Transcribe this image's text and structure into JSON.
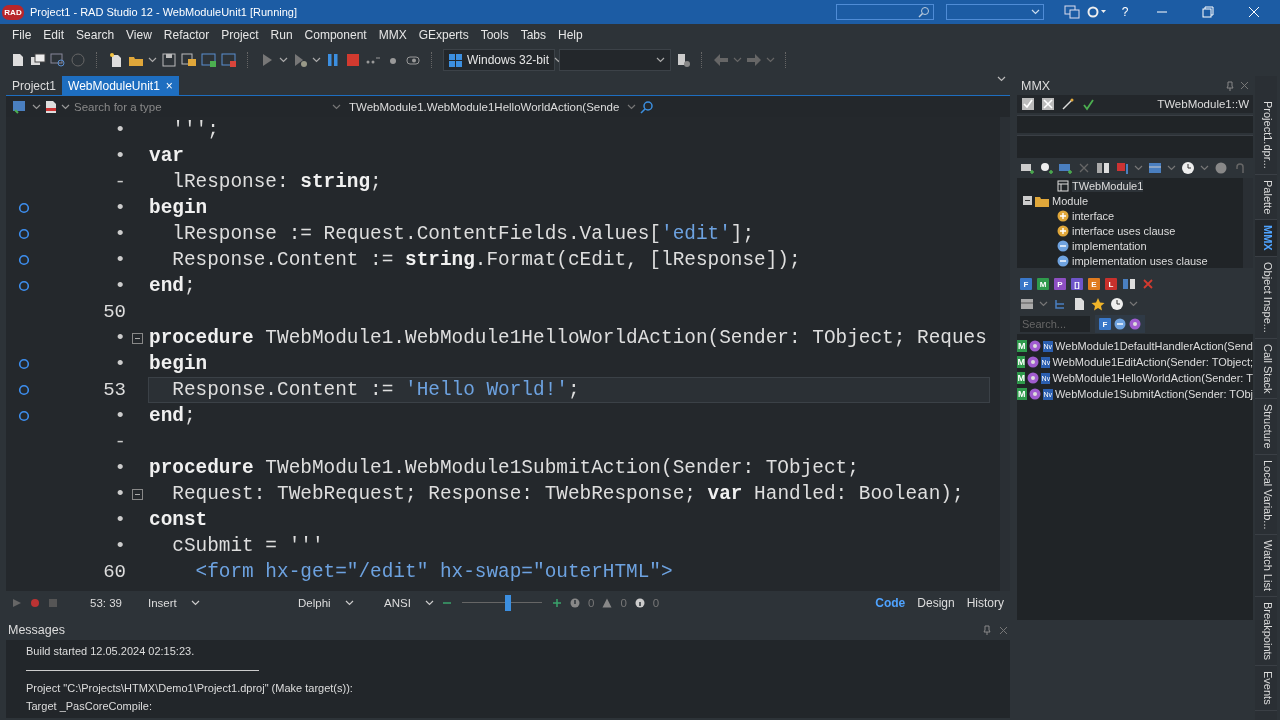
{
  "window": {
    "logo": "RAD",
    "title": "Project1 - RAD Studio 12 - WebModuleUnit1 [Running]",
    "help": "?"
  },
  "menu": [
    "File",
    "Edit",
    "Search",
    "View",
    "Refactor",
    "Project",
    "Run",
    "Component",
    "MMX",
    "GExperts",
    "Tools",
    "Tabs",
    "Help"
  ],
  "toolbar": {
    "platform": "Windows 32-bit"
  },
  "editor": {
    "tabs": [
      {
        "label": "Project1",
        "selected": false
      },
      {
        "label": "WebModuleUnit1",
        "selected": true,
        "close": "×"
      }
    ],
    "search_placeholder": "Search for a type",
    "method": "TWebModule1.WebModule1HelloWorldAction(Sende",
    "lines": [
      {
        "gutter": "•",
        "marker": false,
        "fold": false,
        "current": false,
        "tokens": [
          {
            "kind": "id",
            "text": "  ''';"
          }
        ]
      },
      {
        "gutter": "•",
        "marker": false,
        "fold": false,
        "current": false,
        "tokens": [
          {
            "kind": "kw",
            "text": "var"
          }
        ]
      },
      {
        "gutter": "-",
        "marker": false,
        "fold": false,
        "current": false,
        "tokens": [
          {
            "kind": "id",
            "text": "  lResponse: "
          },
          {
            "kind": "kw",
            "text": "string"
          },
          {
            "kind": "id",
            "text": ";"
          }
        ]
      },
      {
        "gutter": "•",
        "marker": true,
        "fold": false,
        "current": false,
        "tokens": [
          {
            "kind": "kw",
            "text": "begin"
          }
        ]
      },
      {
        "gutter": "•",
        "marker": true,
        "fold": false,
        "current": false,
        "tokens": [
          {
            "kind": "id",
            "text": "  lResponse := Request.ContentFields.Values["
          },
          {
            "kind": "str",
            "text": "'edit'"
          },
          {
            "kind": "id",
            "text": "];"
          }
        ]
      },
      {
        "gutter": "•",
        "marker": true,
        "fold": false,
        "current": false,
        "tokens": [
          {
            "kind": "id",
            "text": "  Response.Content := "
          },
          {
            "kind": "kw",
            "text": "string"
          },
          {
            "kind": "id",
            "text": ".Format(cEdit, [lResponse]);"
          }
        ]
      },
      {
        "gutter": "•",
        "marker": true,
        "fold": false,
        "current": false,
        "tokens": [
          {
            "kind": "kw",
            "text": "end"
          },
          {
            "kind": "id",
            "text": ";"
          }
        ]
      },
      {
        "gutter": "50",
        "marker": false,
        "fold": false,
        "current": false
      },
      {
        "gutter": "•",
        "marker": false,
        "fold": true,
        "current": false,
        "tokens": [
          {
            "kind": "kw",
            "text": "procedure"
          },
          {
            "kind": "id",
            "text": " TWebModule1.WebModule1HelloWorldAction(Sender: TObject; Reques"
          }
        ]
      },
      {
        "gutter": "•",
        "marker": true,
        "fold": false,
        "current": false,
        "tokens": [
          {
            "kind": "kw",
            "text": "begin"
          }
        ]
      },
      {
        "gutter": "53",
        "marker": true,
        "fold": false,
        "current": true,
        "tokens": [
          {
            "kind": "id",
            "text": "  Response.Content := "
          },
          {
            "kind": "str",
            "text": "'Hello World!'"
          },
          {
            "kind": "id",
            "text": ";"
          }
        ]
      },
      {
        "gutter": "•",
        "marker": true,
        "fold": false,
        "current": false,
        "tokens": [
          {
            "kind": "kw",
            "text": "end"
          },
          {
            "kind": "id",
            "text": ";"
          }
        ]
      },
      {
        "gutter": "-",
        "marker": false,
        "fold": false,
        "current": false
      },
      {
        "gutter": "•",
        "marker": false,
        "fold": false,
        "current": false,
        "tokens": [
          {
            "kind": "kw",
            "text": "procedure"
          },
          {
            "kind": "id",
            "text": " TWebModule1.WebModule1SubmitAction(Sender: TObject;"
          }
        ]
      },
      {
        "gutter": "•",
        "marker": false,
        "fold": true,
        "current": false,
        "tokens": [
          {
            "kind": "id",
            "text": "  Request: TWebRequest; Response: TWebResponse; "
          },
          {
            "kind": "kw",
            "text": "var"
          },
          {
            "kind": "id",
            "text": " Handled: Boolean);"
          }
        ]
      },
      {
        "gutter": "•",
        "marker": false,
        "fold": false,
        "current": false,
        "tokens": [
          {
            "kind": "kw",
            "text": "const"
          }
        ]
      },
      {
        "gutter": "•",
        "marker": false,
        "fold": false,
        "current": false,
        "tokens": [
          {
            "kind": "id",
            "text": "  cSubmit = '''"
          }
        ]
      },
      {
        "gutter": "60",
        "marker": false,
        "fold": false,
        "current": false,
        "tokens": [
          {
            "kind": "str",
            "text": "    <form hx-get=\"/edit\" hx-swap=\"outerHTML\">"
          }
        ]
      }
    ]
  },
  "status": {
    "position": "53: 39",
    "mode": "Insert",
    "language": "Delphi",
    "encoding": "ANSI",
    "zoom": {
      "level": 0.58
    },
    "errors": "0",
    "warnings": "0",
    "hints": "0",
    "views": [
      {
        "label": "Code",
        "selected": true
      },
      {
        "label": "Design",
        "selected": false
      },
      {
        "label": "History",
        "selected": false
      }
    ]
  },
  "mmx": {
    "title": "MMX",
    "context": "TWebModule1::W",
    "tree": [
      {
        "text": "TWebModule1",
        "kind": "class",
        "selected": true
      },
      {
        "text": "Module",
        "kind": "folder",
        "selected": false,
        "expanded": true,
        "children": [
          {
            "text": "interface",
            "kind": "plus",
            "selected": false
          },
          {
            "text": "interface uses clause",
            "kind": "plus",
            "selected": false
          },
          {
            "text": "implementation",
            "kind": "minus",
            "selected": false
          },
          {
            "text": "implementation uses clause",
            "kind": "minus",
            "selected": false
          }
        ]
      }
    ],
    "add_buttons": [
      {
        "label": "F",
        "color": "#3a78c9"
      },
      {
        "label": "M",
        "color": "#2f9a4c"
      },
      {
        "label": "P",
        "color": "#8d4fc2"
      },
      {
        "label": "[]",
        "color": "#6e55c9"
      },
      {
        "label": "E",
        "color": "#e07b1f"
      },
      {
        "label": "L",
        "color": "#c8312c"
      }
    ],
    "search_placeholder": "Search...",
    "filter": "F",
    "members": [
      {
        "badge": "M",
        "tag": "Nv",
        "text": "WebModule1DefaultHandlerAction(Send"
      },
      {
        "badge": "M",
        "tag": "Nv",
        "text": "WebModule1EditAction(Sender: TObject;"
      },
      {
        "badge": "M",
        "tag": "Nv",
        "text": "WebModule1HelloWorldAction(Sender: T"
      },
      {
        "badge": "M",
        "tag": "Nv",
        "text": "WebModule1SubmitAction(Sender: TObj"
      }
    ]
  },
  "side_tabs": [
    {
      "label": "Project1.dpr...",
      "selected": false
    },
    {
      "label": "Palette",
      "selected": false
    },
    {
      "label": "MMX",
      "selected": true
    },
    {
      "label": "Object Inspe...",
      "selected": false
    },
    {
      "label": "Call Stack",
      "selected": false
    },
    {
      "label": "Structure",
      "selected": false
    },
    {
      "label": "Local Variab...",
      "selected": false
    },
    {
      "label": "Watch List",
      "selected": false
    },
    {
      "label": "Breakpoints",
      "selected": false
    },
    {
      "label": "Events",
      "selected": false
    }
  ],
  "messages": {
    "title": "Messages",
    "lines": [
      {
        "kind": "text",
        "text": "Build started 12.05.2024 02:15:23."
      },
      {
        "kind": "rule"
      },
      {
        "kind": "text",
        "text": "Project \"C:\\Projects\\HTMX\\Demo1\\Project1.dproj\" (Make target(s)):"
      },
      {
        "kind": "text",
        "text": "Target _PasCoreCompile:"
      }
    ]
  }
}
